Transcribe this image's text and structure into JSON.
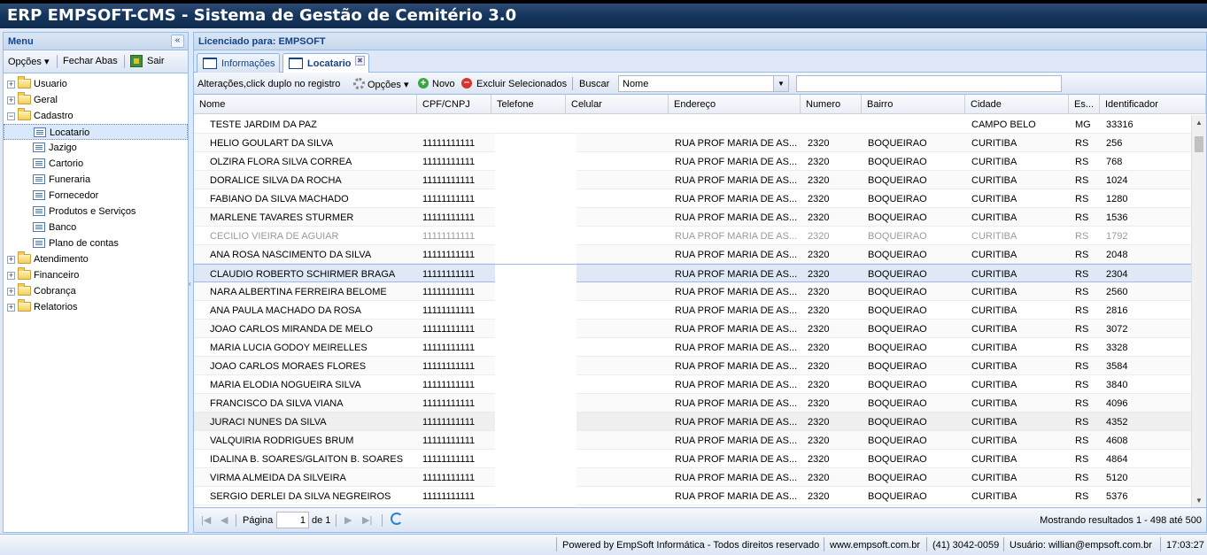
{
  "app": {
    "title": "ERP EMPSOFT-CMS - Sistema de Gestão de Cemitério 3.0"
  },
  "menu": {
    "title": "Menu",
    "collapse_icon": "«",
    "toolbar": {
      "options_label": "Opções ▾",
      "close_tabs_label": "Fechar Abas",
      "exit_label": "Sair"
    },
    "tree": [
      {
        "label": "Usuario",
        "type": "folder",
        "expanded": false
      },
      {
        "label": "Geral",
        "type": "folder",
        "expanded": false
      },
      {
        "label": "Cadastro",
        "type": "folder",
        "expanded": true
      },
      {
        "label": "Locatario",
        "type": "leaf",
        "selected": true
      },
      {
        "label": "Jazigo",
        "type": "leaf"
      },
      {
        "label": "Cartorio",
        "type": "leaf"
      },
      {
        "label": "Funeraria",
        "type": "leaf"
      },
      {
        "label": "Fornecedor",
        "type": "leaf"
      },
      {
        "label": "Produtos e Serviços",
        "type": "leaf"
      },
      {
        "label": "Banco",
        "type": "leaf"
      },
      {
        "label": "Plano de contas",
        "type": "leaf"
      },
      {
        "label": "Atendimento",
        "type": "folder",
        "expanded": false
      },
      {
        "label": "Financeiro",
        "type": "folder",
        "expanded": false
      },
      {
        "label": "Cobrança",
        "type": "folder",
        "expanded": false
      },
      {
        "label": "Relatorios",
        "type": "folder",
        "expanded": false
      }
    ]
  },
  "header": {
    "licensed_label": "Licenciado para:  EMPSOFT"
  },
  "tabs": [
    {
      "label": "Informações",
      "active": false
    },
    {
      "label": "Locatario",
      "active": true,
      "close_icon": "✖"
    }
  ],
  "grid_toolbar": {
    "hint": "Alterações,click duplo no registro",
    "options_label": "Opções ▾",
    "new_label": "Novo",
    "delete_label": "Excluir Selecionados",
    "search_label": "Buscar",
    "search_field": "Nome",
    "search_field_arrow": "▼",
    "search_value": ""
  },
  "columns": [
    "Nome",
    "CPF/CNPJ",
    "Telefone",
    "Celular",
    "Endereço",
    "Numero",
    "Bairro",
    "Cidade",
    "Es...",
    "Identificador"
  ],
  "rows": [
    [
      "TESTE JARDIM DA PAZ",
      "",
      "",
      "",
      "",
      "",
      "",
      "CAMPO BELO",
      "MG",
      "33316"
    ],
    [
      "HELIO GOULART DA SILVA",
      "11111111111",
      "",
      "",
      "RUA PROF MARIA DE AS...",
      "2320",
      "BOQUEIRAO",
      "CURITIBA",
      "RS",
      "256"
    ],
    [
      "OLZIRA FLORA SILVA CORREA",
      "11111111111",
      "",
      "",
      "RUA PROF MARIA DE AS...",
      "2320",
      "BOQUEIRAO",
      "CURITIBA",
      "RS",
      "768"
    ],
    [
      "DORALICE SILVA DA ROCHA",
      "11111111111",
      "",
      "",
      "RUA PROF MARIA DE AS...",
      "2320",
      "BOQUEIRAO",
      "CURITIBA",
      "RS",
      "1024"
    ],
    [
      "FABIANO DA SILVA MACHADO",
      "11111111111",
      "",
      "",
      "RUA PROF MARIA DE AS...",
      "2320",
      "BOQUEIRAO",
      "CURITIBA",
      "RS",
      "1280"
    ],
    [
      "MARLENE TAVARES STURMER",
      "11111111111",
      "",
      "",
      "RUA PROF MARIA DE AS...",
      "2320",
      "BOQUEIRAO",
      "CURITIBA",
      "RS",
      "1536"
    ],
    [
      "CECILIO VIEIRA DE AGUIAR",
      "11111111111",
      "",
      "",
      "RUA PROF MARIA DE AS...",
      "2320",
      "BOQUEIRAO",
      "CURITIBA",
      "RS",
      "1792"
    ],
    [
      "ANA ROSA NASCIMENTO DA SILVA",
      "11111111111",
      "",
      "",
      "RUA PROF MARIA DE AS...",
      "2320",
      "BOQUEIRAO",
      "CURITIBA",
      "RS",
      "2048"
    ],
    [
      "CLAUDIO ROBERTO SCHIRMER BRAGA",
      "11111111111",
      "",
      "",
      "RUA PROF MARIA DE AS...",
      "2320",
      "BOQUEIRAO",
      "CURITIBA",
      "RS",
      "2304"
    ],
    [
      "NARA ALBERTINA FERREIRA BELOME",
      "11111111111",
      "",
      "",
      "RUA PROF MARIA DE AS...",
      "2320",
      "BOQUEIRAO",
      "CURITIBA",
      "RS",
      "2560"
    ],
    [
      "ANA PAULA MACHADO DA ROSA",
      "11111111111",
      "",
      "",
      "RUA PROF MARIA DE AS...",
      "2320",
      "BOQUEIRAO",
      "CURITIBA",
      "RS",
      "2816"
    ],
    [
      "JOAO CARLOS MIRANDA DE MELO",
      "11111111111",
      "",
      "",
      "RUA PROF MARIA DE AS...",
      "2320",
      "BOQUEIRAO",
      "CURITIBA",
      "RS",
      "3072"
    ],
    [
      "MARIA LUCIA GODOY MEIRELLES",
      "11111111111",
      "",
      "",
      "RUA PROF MARIA DE AS...",
      "2320",
      "BOQUEIRAO",
      "CURITIBA",
      "RS",
      "3328"
    ],
    [
      "JOAO CARLOS MORAES FLORES",
      "11111111111",
      "",
      "",
      "RUA PROF MARIA DE AS...",
      "2320",
      "BOQUEIRAO",
      "CURITIBA",
      "RS",
      "3584"
    ],
    [
      "MARIA ELODIA NOGUEIRA SILVA",
      "11111111111",
      "",
      "",
      "RUA PROF MARIA DE AS...",
      "2320",
      "BOQUEIRAO",
      "CURITIBA",
      "RS",
      "3840"
    ],
    [
      "FRANCISCO DA SILVA VIANA",
      "11111111111",
      "",
      "",
      "RUA PROF MARIA DE AS...",
      "2320",
      "BOQUEIRAO",
      "CURITIBA",
      "RS",
      "4096"
    ],
    [
      "JURACI NUNES DA SILVA",
      "11111111111",
      "",
      "",
      "RUA PROF MARIA DE AS...",
      "2320",
      "BOQUEIRAO",
      "CURITIBA",
      "RS",
      "4352"
    ],
    [
      "VALQUIRIA RODRIGUES BRUM",
      "11111111111",
      "",
      "",
      "RUA PROF MARIA DE AS...",
      "2320",
      "BOQUEIRAO",
      "CURITIBA",
      "RS",
      "4608"
    ],
    [
      "IDALINA B. SOARES/GLAITON B. SOARES",
      "11111111111",
      "",
      "",
      "RUA PROF MARIA DE AS...",
      "2320",
      "BOQUEIRAO",
      "CURITIBA",
      "RS",
      "4864"
    ],
    [
      "VIRMA ALMEIDA DA SILVEIRA",
      "11111111111",
      "",
      "",
      "RUA PROF MARIA DE AS...",
      "2320",
      "BOQUEIRAO",
      "CURITIBA",
      "RS",
      "5120"
    ],
    [
      "SERGIO DERLEI DA SILVA NEGREIROS",
      "11111111111",
      "",
      "",
      "RUA PROF MARIA DE AS...",
      "2320",
      "BOQUEIRAO",
      "CURITIBA",
      "RS",
      "5376"
    ]
  ],
  "row_states": {
    "disabled_row": 6,
    "selected_row": 8,
    "hover_row": 16
  },
  "pager": {
    "first_icon": "|◀",
    "prev_icon": "◀",
    "next_icon": "▶",
    "last_icon": "▶|",
    "page_label": "Página",
    "page_value": "1",
    "of_label": "de 1",
    "summary": "Mostrando resultados 1 - 498 até 500"
  },
  "scrollbar": {
    "up_icon": "▲",
    "down_icon": "▼"
  },
  "statusbar": {
    "powered": "Powered by EmpSoft Informática - Todos direitos reservado",
    "site": "www.empsoft.com.br",
    "phone": "(41) 3042-0059",
    "user": "Usuário:  willian@empsoft.com.br",
    "time": "17:03:27"
  },
  "colors": {
    "title_bar": "#17375e",
    "panel_border": "#99bbe8",
    "header_text": "#15428b",
    "selected_row": "#dfe8f6"
  }
}
